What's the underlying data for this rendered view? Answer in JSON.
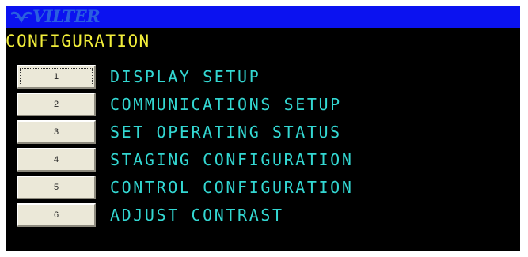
{
  "header": {
    "logo_text": "VILTER",
    "logo_icon": "vilter-logo-icon",
    "bar_color": "#0b12f0"
  },
  "screen": {
    "title": "CONFIGURATION",
    "title_color": "#f2ee3a",
    "label_color": "#33d7d2"
  },
  "menu": {
    "items": [
      {
        "number": "1",
        "label": "DISPLAY SETUP"
      },
      {
        "number": "2",
        "label": "COMMUNICATIONS SETUP"
      },
      {
        "number": "3",
        "label": "SET OPERATING STATUS"
      },
      {
        "number": "4",
        "label": "STAGING CONFIGURATION"
      },
      {
        "number": "5",
        "label": "CONTROL CONFIGURATION"
      },
      {
        "number": "6",
        "label": "ADJUST CONTRAST"
      }
    ]
  }
}
